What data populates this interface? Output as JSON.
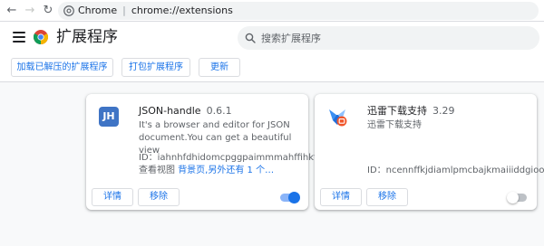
{
  "address_bar": {
    "site_label": "Chrome",
    "url": "chrome://extensions"
  },
  "header": {
    "title": "扩展程序",
    "search_placeholder": "搜索扩展程序"
  },
  "toolbar": {
    "load_unpacked": "加载已解压的扩展程序",
    "pack_extension": "打包扩展程序",
    "update": "更新"
  },
  "extensions": [
    {
      "name": "JSON-handle",
      "version": "0.6.1",
      "icon_text": "JH",
      "description": "It's a browser and editor for JSON document.You can get a beautiful view",
      "id_line": "ID：iahnhfdhidomcpggpaimmmahffihkfnj",
      "inspect_label": "查看视图",
      "inspect_link": "背景页,另外还有 1 个…",
      "details_label": "详情",
      "remove_label": "移除",
      "enabled": true
    },
    {
      "name": "迅雷下载支持",
      "version": "3.29",
      "description": "迅雷下载支持",
      "id_line": "ID：ncennffkjdiamlpmcbajkmaiiiddgioo",
      "details_label": "详情",
      "remove_label": "移除",
      "enabled": false
    }
  ],
  "colors": {
    "accent": "#1a73e8",
    "page_bg": "#f8f9fa",
    "jh_icon_bg": "#3f74c5",
    "thunder_blue": "#3b8ff2",
    "thunder_badge": "#f0552a"
  }
}
